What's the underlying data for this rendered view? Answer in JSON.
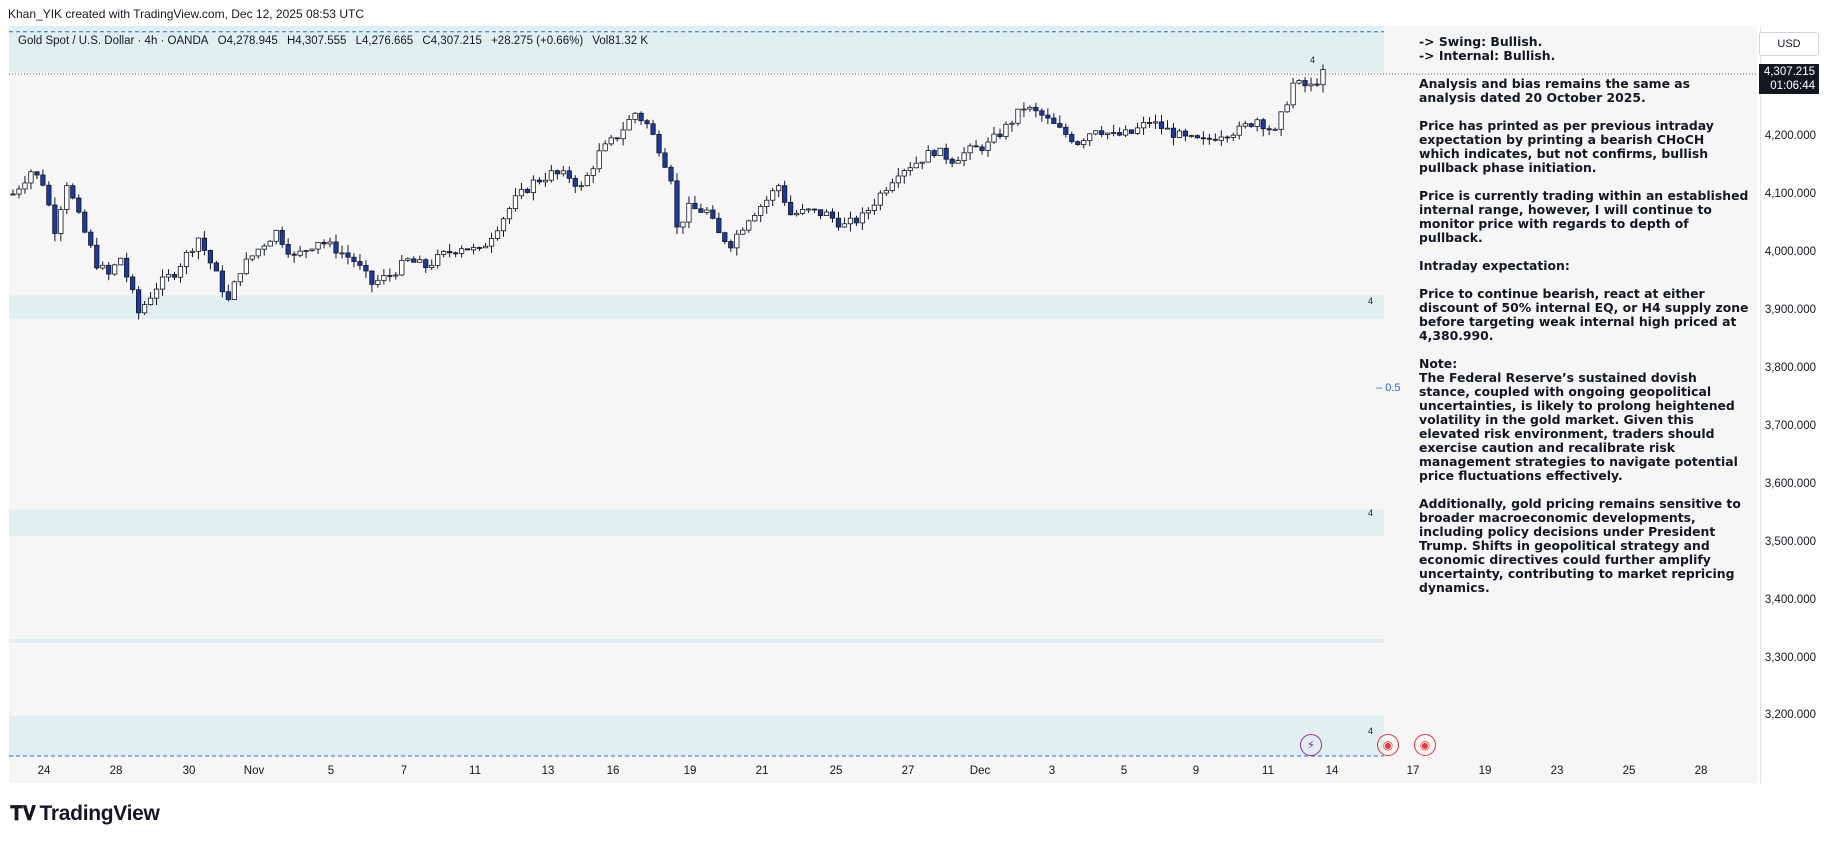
{
  "header": {
    "credit": "Khan_YIK created with TradingView.com, Dec 12, 2025 08:53 UTC"
  },
  "ohlc": {
    "symbol": "Gold Spot / U.S. Dollar · 4h · OANDA",
    "open": "O4,278.945",
    "high": "H4,307.555",
    "low": "L4,276.665",
    "close": "C4,307.215",
    "change": "+28.275 (+0.66%)",
    "volume": "Vol81.32 K"
  },
  "currency": "USD",
  "last_price": {
    "price": "4,307.215",
    "countdown": "01:06:44"
  },
  "eq_label": "0.5",
  "zone_marker": "4",
  "notes": {
    "swing": "-> Swing:  Bullish.",
    "internal": "-> Internal:  Bullish.",
    "p1": "Analysis and bias remains the same as analysis dated 20 October 2025.",
    "p2": "Price has printed as per previous intraday expectation by printing a bearish CHoCH which indicates, but not confirms, bullish pullback phase initiation.",
    "p3": "Price is currently trading within an established internal range, however, I will continue to monitor price with regards to depth of pullback.",
    "p4": "Intraday expectation:",
    "p5": "Price to continue bearish, react at either discount of 50% internal EQ, or H4 supply zone before targeting weak internal high priced at 4,380.990.",
    "p6_title": "Note:",
    "p6": "The Federal Reserve’s sustained dovish stance, coupled with ongoing geopolitical uncertainties, is likely to prolong heightened volatility in the gold market. Given this elevated risk environment, traders should exercise caution and recalibrate risk management strategies to navigate potential price fluctuations effectively.",
    "p7": "Additionally, gold pricing remains sensitive to broader macroeconomic developments, including policy decisions under President Trump. Shifts in geopolitical strategy and economic directives could further amplify uncertainty, contributing to market repricing dynamics."
  },
  "footer": {
    "brand": "TradingView"
  },
  "colors": {
    "up": "#ffffff",
    "down": "#1a3a9e",
    "wick": "#131722",
    "zone": "#e0f0f0",
    "dash": "#2962ff",
    "bg": "#f6f6f7"
  },
  "chart_data": {
    "type": "candlestick",
    "title": "Gold Spot / U.S. Dollar · 4h · OANDA",
    "ylim": [
      3130,
      4390
    ],
    "y_ticks": [
      "3,200.000",
      "3,300.000",
      "3,400.000",
      "3,500.000",
      "3,600.000",
      "3,700.000",
      "3,800.000",
      "3,900.000",
      "4,000.000",
      "4,100.000",
      "4,200.000"
    ],
    "y_tick_values": [
      3200,
      3300,
      3400,
      3500,
      3600,
      3700,
      3800,
      3900,
      4000,
      4100,
      4200
    ],
    "x_ticks": [
      "24",
      "28",
      "30",
      "Nov",
      "5",
      "7",
      "11",
      "13",
      "16",
      "19",
      "21",
      "25",
      "27",
      "Dec",
      "3",
      "5",
      "9",
      "11",
      "14",
      "17",
      "19",
      "23",
      "25",
      "28"
    ],
    "zones": [
      {
        "from": 4310,
        "to": 4390
      },
      {
        "from": 3885,
        "to": 3925
      },
      {
        "from": 3510,
        "to": 3555
      },
      {
        "from": 3325,
        "to": 3332
      },
      {
        "from": 3130,
        "to": 3200
      }
    ],
    "dashed_levels": [
      4380,
      3130
    ],
    "eq_level": 3742,
    "price_path": [
      [
        0,
        4100
      ],
      [
        3,
        4140
      ],
      [
        5,
        4120
      ],
      [
        7,
        4040
      ],
      [
        9,
        4120
      ],
      [
        11,
        4060
      ],
      [
        14,
        3980
      ],
      [
        16,
        3960
      ],
      [
        18,
        3990
      ],
      [
        21,
        3895
      ],
      [
        24,
        3940
      ],
      [
        27,
        3965
      ],
      [
        31,
        4025
      ],
      [
        34,
        3960
      ],
      [
        36,
        3915
      ],
      [
        38,
        3970
      ],
      [
        41,
        4005
      ],
      [
        44,
        4035
      ],
      [
        47,
        3990
      ],
      [
        51,
        4020
      ],
      [
        54,
        4005
      ],
      [
        57,
        3985
      ],
      [
        60,
        3945
      ],
      [
        63,
        3960
      ],
      [
        66,
        3985
      ],
      [
        69,
        3975
      ],
      [
        72,
        3995
      ],
      [
        75,
        4010
      ],
      [
        78,
        4000
      ],
      [
        81,
        4045
      ],
      [
        84,
        4090
      ],
      [
        87,
        4120
      ],
      [
        90,
        4135
      ],
      [
        93,
        4130
      ],
      [
        95,
        4110
      ],
      [
        98,
        4170
      ],
      [
        101,
        4200
      ],
      [
        104,
        4240
      ],
      [
        106,
        4220
      ],
      [
        108,
        4180
      ],
      [
        110,
        4130
      ],
      [
        111,
        4040
      ],
      [
        113,
        4075
      ],
      [
        116,
        4070
      ],
      [
        118,
        4030
      ],
      [
        120,
        4015
      ],
      [
        123,
        4060
      ],
      [
        126,
        4090
      ],
      [
        128,
        4115
      ],
      [
        130,
        4065
      ],
      [
        133,
        4070
      ],
      [
        136,
        4065
      ],
      [
        139,
        4045
      ],
      [
        142,
        4060
      ],
      [
        145,
        4100
      ],
      [
        148,
        4140
      ],
      [
        151,
        4155
      ],
      [
        154,
        4175
      ],
      [
        157,
        4160
      ],
      [
        160,
        4175
      ],
      [
        163,
        4185
      ],
      [
        166,
        4215
      ],
      [
        169,
        4250
      ],
      [
        172,
        4235
      ],
      [
        175,
        4210
      ],
      [
        178,
        4190
      ],
      [
        181,
        4215
      ],
      [
        184,
        4200
      ],
      [
        187,
        4205
      ],
      [
        190,
        4225
      ],
      [
        193,
        4210
      ],
      [
        196,
        4195
      ],
      [
        199,
        4190
      ],
      [
        202,
        4205
      ],
      [
        205,
        4210
      ],
      [
        208,
        4230
      ],
      [
        211,
        4205
      ],
      [
        214,
        4290
      ],
      [
        217,
        4285
      ],
      [
        219,
        4307
      ]
    ]
  }
}
